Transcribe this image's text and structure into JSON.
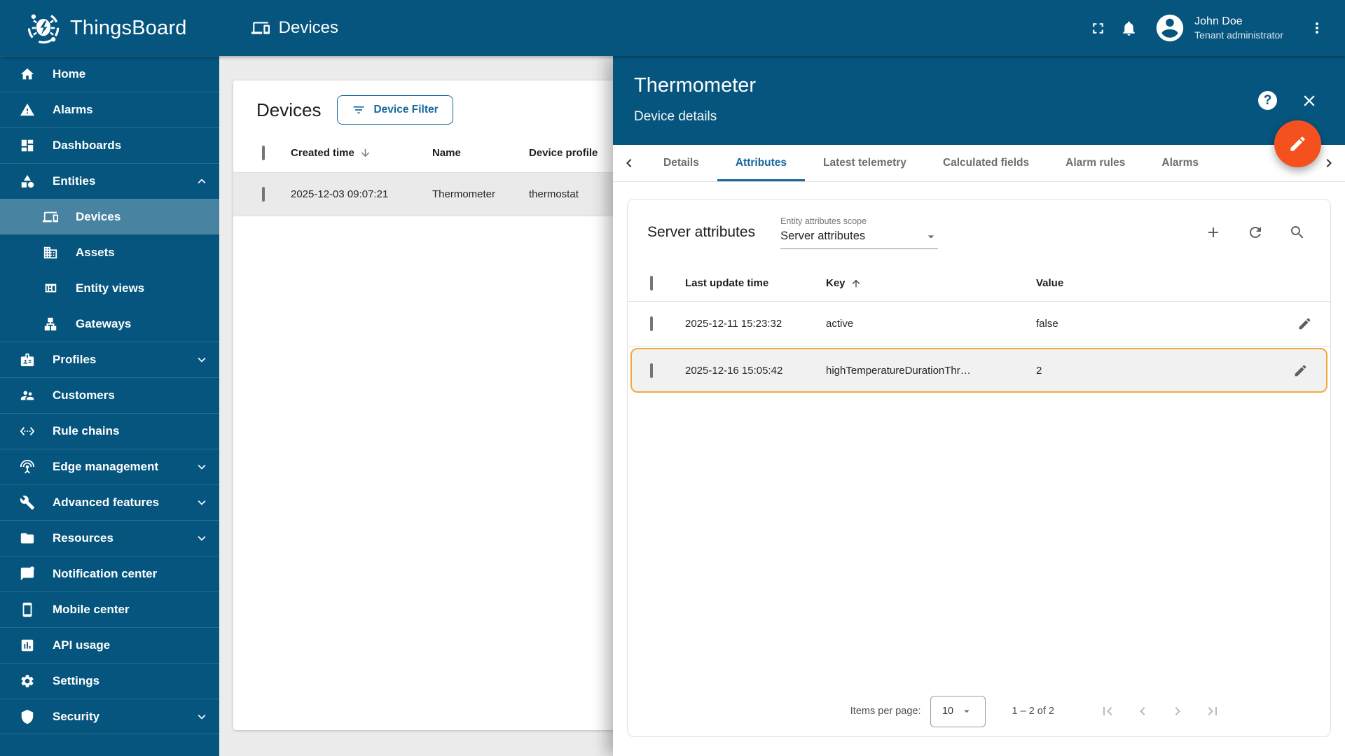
{
  "header": {
    "app_name": "ThingsBoard",
    "page_title": "Devices",
    "user": {
      "name": "John Doe",
      "role": "Tenant administrator"
    }
  },
  "sidebar": {
    "items": [
      {
        "label": "Home"
      },
      {
        "label": "Alarms"
      },
      {
        "label": "Dashboards"
      },
      {
        "label": "Entities"
      },
      {
        "label": "Devices"
      },
      {
        "label": "Assets"
      },
      {
        "label": "Entity views"
      },
      {
        "label": "Gateways"
      },
      {
        "label": "Profiles"
      },
      {
        "label": "Customers"
      },
      {
        "label": "Rule chains"
      },
      {
        "label": "Edge management"
      },
      {
        "label": "Advanced features"
      },
      {
        "label": "Resources"
      },
      {
        "label": "Notification center"
      },
      {
        "label": "Mobile center"
      },
      {
        "label": "API usage"
      },
      {
        "label": "Settings"
      },
      {
        "label": "Security"
      }
    ],
    "active_item": "Devices"
  },
  "devices": {
    "title": "Devices",
    "filter_button_label": "Device Filter",
    "columns": [
      "Created time",
      "Name",
      "Device profile"
    ],
    "sort_column": "Created time",
    "sort_direction": "desc",
    "rows": [
      {
        "created_time": "2025-12-03 09:07:21",
        "name": "Thermometer",
        "device_profile": "thermostat"
      }
    ]
  },
  "panel": {
    "title": "Thermometer",
    "subtitle": "Device details",
    "tabs": [
      "Details",
      "Attributes",
      "Latest telemetry",
      "Calculated fields",
      "Alarm rules",
      "Alarms"
    ],
    "active_tab": "Attributes"
  },
  "attributes": {
    "title": "Server attributes",
    "scope_label": "Entity attributes scope",
    "scope_value": "Server attributes",
    "columns": [
      "Last update time",
      "Key",
      "Value"
    ],
    "sort_column": "Key",
    "sort_direction": "asc",
    "rows": [
      {
        "last_update_time": "2025-12-11 15:23:32",
        "key": "active",
        "value": "false",
        "highlighted": false
      },
      {
        "last_update_time": "2025-12-16 15:05:42",
        "key": "highTemperatureDurationThr…",
        "value": "2",
        "highlighted": true
      }
    ],
    "pagination": {
      "items_per_page_label": "Items per page:",
      "items_per_page": "10",
      "range": "1 – 2 of 2"
    }
  },
  "colors": {
    "primary_blue": "#05557E",
    "accent_blue": "#16689D",
    "fab_orange": "#F4511E",
    "highlight_amber": "#F2A93B",
    "background_gray": "#ECECEC"
  }
}
